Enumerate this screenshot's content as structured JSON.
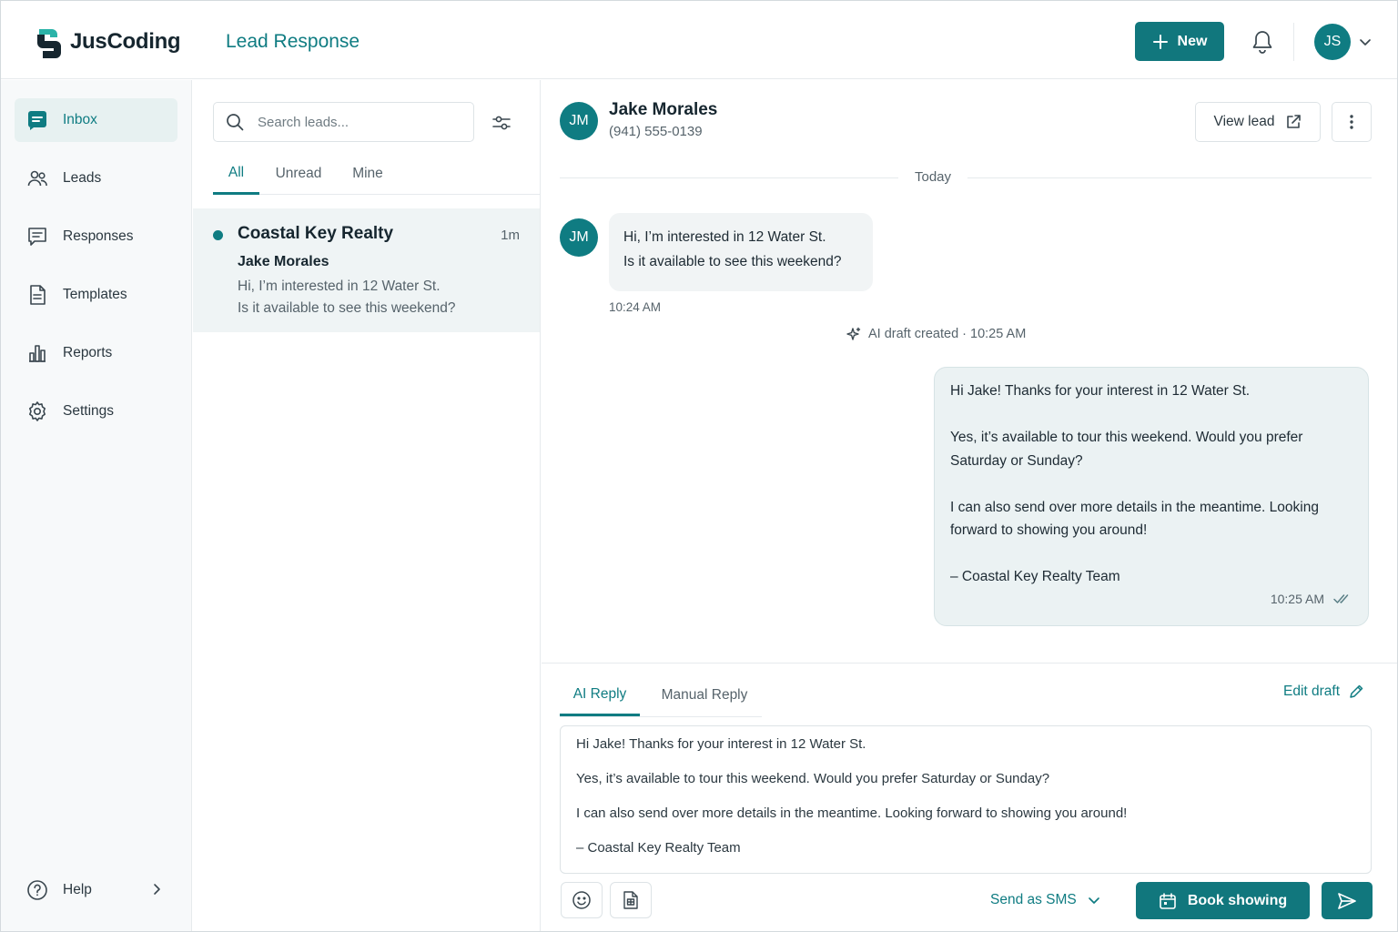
{
  "app": {
    "name": "JusCoding",
    "page_title": "Lead Response"
  },
  "header": {
    "new_label": "New",
    "user_initials": "JS"
  },
  "colors": {
    "accent": "#0f7c82",
    "accent_dark": "#11777d",
    "active_bg": "#e7f1f1"
  },
  "sidebar": {
    "items": [
      {
        "label": "Inbox",
        "icon": "inbox-icon",
        "active": true
      },
      {
        "label": "Leads",
        "icon": "users-icon"
      },
      {
        "label": "Responses",
        "icon": "chat-icon"
      },
      {
        "label": "Templates",
        "icon": "document-icon"
      },
      {
        "label": "Reports",
        "icon": "bar-chart-icon"
      },
      {
        "label": "Settings",
        "icon": "gear-icon"
      }
    ],
    "help_label": "Help"
  },
  "leadlist": {
    "search_placeholder": "Search leads...",
    "tabs": [
      "All",
      "Unread",
      "Mine"
    ],
    "active_tab": "All",
    "leads": [
      {
        "company": "Coastal Key Realty",
        "time": "1m",
        "name": "Jake Morales",
        "preview_line1": "Hi, I’m interested in 12 Water St.",
        "preview_line2": "Is it available to see this weekend?",
        "unread": true
      }
    ]
  },
  "conversation": {
    "contact_initials": "JM",
    "contact_name": "Jake Morales",
    "contact_phone": "(941) 555-0139",
    "view_lead_label": "View lead",
    "day_label": "Today",
    "incoming": {
      "line1": "Hi, I’m interested in 12 Water St.",
      "line2": "Is it available to see this weekend?",
      "time": "10:24 AM"
    },
    "ai_created": "AI draft created · 10:25 AM",
    "outgoing": {
      "p1": "Hi Jake! Thanks for your interest in 12 Water St.",
      "p2": "Yes, it’s available to tour this weekend. Would you prefer Saturday or Sunday?",
      "p3": "I can also send over more details in the meantime. Looking forward to showing you around!",
      "p4": "– Coastal Key Realty Team",
      "time": "10:25 AM"
    }
  },
  "composer": {
    "tabs": [
      "AI Reply",
      "Manual Reply"
    ],
    "active_tab": "AI Reply",
    "edit_draft_label": "Edit draft",
    "draft": {
      "p1": "Hi Jake! Thanks for your interest in 12 Water St.",
      "p2": "Yes, it’s available to tour this weekend. Would you prefer Saturday or Sunday?",
      "p3": "I can also send over more details in the meantime. Looking forward to showing you around!",
      "p4": "– Coastal Key Realty Team"
    },
    "send_as_label": "Send as SMS",
    "book_label": "Book showing"
  }
}
